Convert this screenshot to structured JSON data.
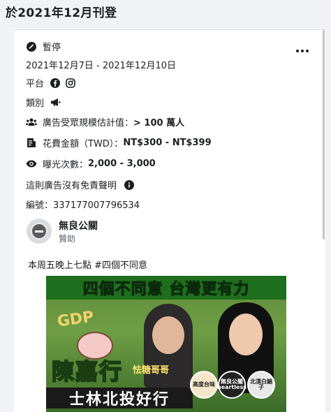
{
  "header": {
    "title": "於2021年12月刊登"
  },
  "ad": {
    "status": "暫停",
    "date_range": "2021年12月7日 - 2021年12月10日",
    "platform_label": "平台",
    "platform_icons": [
      "facebook-icon",
      "instagram-icon"
    ],
    "category_label": "類別",
    "category_icon": "megaphone-icon",
    "audience_label": "廣告受眾規模估計值：",
    "audience_value": "> 100 萬人",
    "spend_label": "花費金額（TWD）：",
    "spend_value": "NT$300 - NT$399",
    "impressions_label": "曝光次數：",
    "impressions_value": "2,000 - 3,000",
    "disclaimer": "這則廣告沒有免責聲明",
    "id_text": "編號：337177007796534",
    "page_name": "無良公關",
    "sponsored": "贊助",
    "body_text": "本周五晚上七點 #四個不同意"
  },
  "creative": {
    "banner": "四個不同意 台灣更有力",
    "gdp": "GDP",
    "name": "陳嘉行",
    "nickname": "怯糖哥哥",
    "bottom": "士林北投好行",
    "badge_1": "高度台味",
    "badge_2": "無良公關 heartless",
    "badge_3": "北漂白鯧子"
  },
  "colors": {
    "accent": "#1c1e21",
    "secondary_text": "#606770",
    "banner_green": "#1f6e1d"
  }
}
